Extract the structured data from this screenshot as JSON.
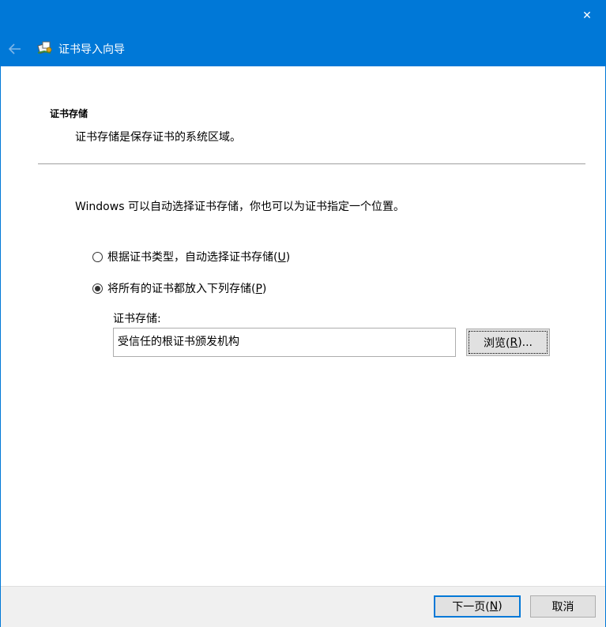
{
  "window": {
    "close_glyph": "✕"
  },
  "header": {
    "title": "证书导入向导",
    "back_icon": "arrow-left-icon",
    "wizard_icon": "certificate-icon"
  },
  "section": {
    "title": "证书存储",
    "description": "证书存储是保存证书的系统区域。"
  },
  "info_text": "Windows 可以自动选择证书存储，你也可以为证书指定一个位置。",
  "options": [
    {
      "label_pre": "根据证书类型，自动选择证书存储(",
      "accel": "U",
      "label_post": ")",
      "checked": false
    },
    {
      "label_pre": "将所有的证书都放入下列存储(",
      "accel": "P",
      "label_post": ")",
      "checked": true
    }
  ],
  "store": {
    "label": "证书存储:",
    "value": "受信任的根证书颁发机构",
    "browse_pre": "浏览(",
    "browse_accel": "R",
    "browse_post": ")..."
  },
  "footer": {
    "next_pre": "下一页(",
    "next_accel": "N",
    "next_post": ")",
    "cancel": "取消"
  },
  "colors": {
    "accent": "#0078d7",
    "footer_bg": "#f0f0f0",
    "button_bg": "#e1e1e1"
  }
}
